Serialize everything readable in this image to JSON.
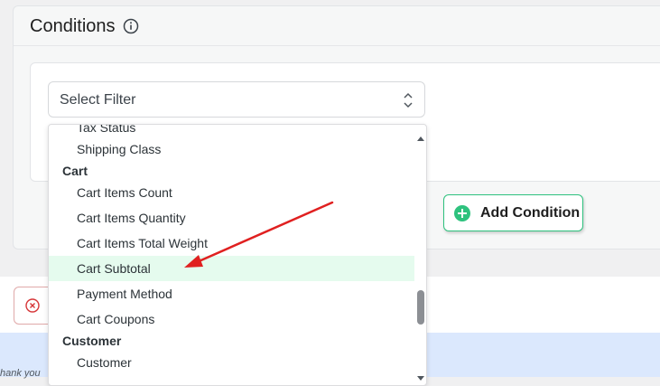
{
  "panel": {
    "title": "Conditions"
  },
  "select": {
    "placeholder": "Select Filter"
  },
  "dropdown": {
    "items": [
      {
        "type": "option",
        "label": "Tax Status"
      },
      {
        "type": "option",
        "label": "Shipping Class"
      },
      {
        "type": "group",
        "label": "Cart"
      },
      {
        "type": "option",
        "label": "Cart Items Count"
      },
      {
        "type": "option",
        "label": "Cart Items Quantity"
      },
      {
        "type": "option",
        "label": "Cart Items Total Weight"
      },
      {
        "type": "option",
        "label": "Cart Subtotal",
        "highlighted": true
      },
      {
        "type": "option",
        "label": "Payment Method"
      },
      {
        "type": "option",
        "label": "Cart Coupons"
      },
      {
        "type": "group",
        "label": "Customer"
      },
      {
        "type": "option",
        "label": "Customer"
      }
    ]
  },
  "add_button": {
    "label": "Add Condition"
  },
  "footer": {
    "text": "hank you"
  },
  "colors": {
    "accent_green": "#2ec27e",
    "highlight": "#e5fbee",
    "arrow_red": "#e02020",
    "remove_red": "#d63638",
    "footer_blue": "#dbe8fd"
  }
}
